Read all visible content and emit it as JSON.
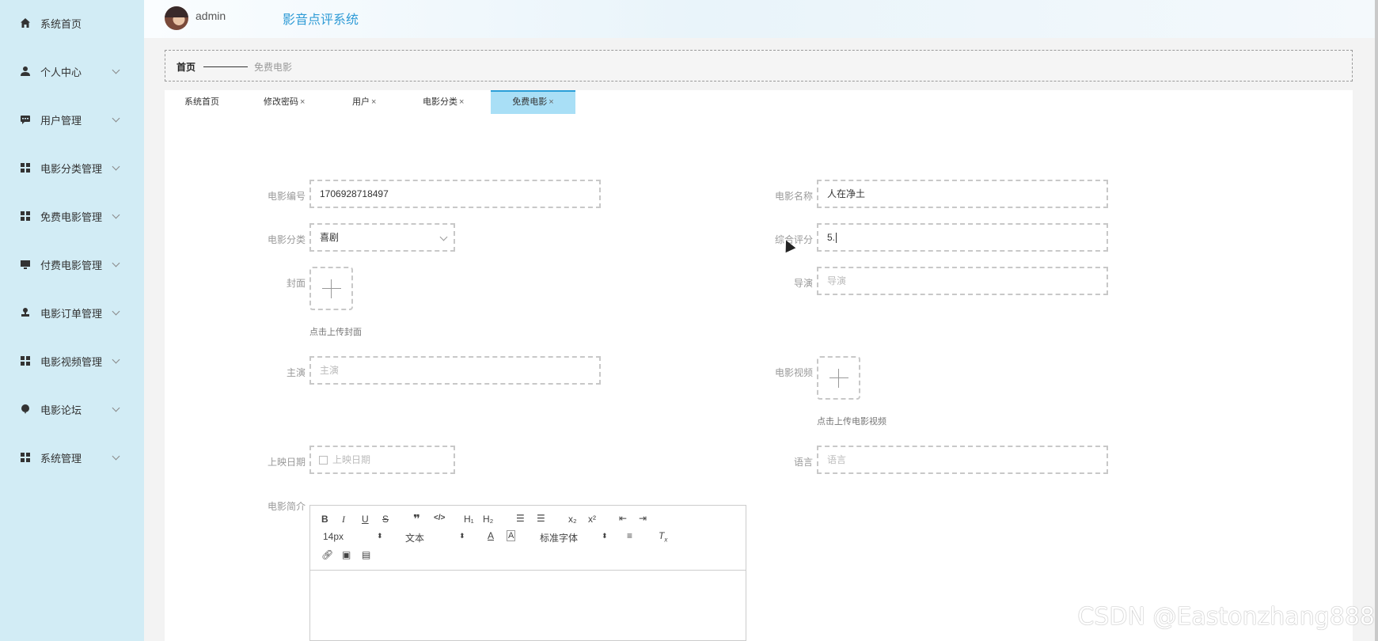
{
  "app": {
    "title": "影音点评系统",
    "username": "admin"
  },
  "sidebar": {
    "items": [
      {
        "label": "系统首页",
        "icon": "home-icon",
        "has_children": false
      },
      {
        "label": "个人中心",
        "icon": "user-icon",
        "has_children": true
      },
      {
        "label": "用户管理",
        "icon": "chat-icon",
        "has_children": true
      },
      {
        "label": "电影分类管理",
        "icon": "grid-icon",
        "has_children": true
      },
      {
        "label": "免费电影管理",
        "icon": "grid-icon",
        "has_children": true
      },
      {
        "label": "付费电影管理",
        "icon": "monitor-icon",
        "has_children": true
      },
      {
        "label": "电影订单管理",
        "icon": "stamp-icon",
        "has_children": true
      },
      {
        "label": "电影视频管理",
        "icon": "grid-icon",
        "has_children": true
      },
      {
        "label": "电影论坛",
        "icon": "balloon-icon",
        "has_children": true
      },
      {
        "label": "系统管理",
        "icon": "grid-icon",
        "has_children": true
      }
    ]
  },
  "breadcrumb": {
    "home": "首页",
    "current": "免费电影"
  },
  "tabs": [
    {
      "label": "系统首页",
      "closable": false,
      "active": false
    },
    {
      "label": "修改密码",
      "closable": true,
      "active": false
    },
    {
      "label": "用户",
      "closable": true,
      "active": false
    },
    {
      "label": "电影分类",
      "closable": true,
      "active": false
    },
    {
      "label": "免费电影",
      "closable": true,
      "active": true
    }
  ],
  "tab_close_glyph": "×",
  "form": {
    "movie_no": {
      "label": "电影编号",
      "value": "1706928718497"
    },
    "movie_name": {
      "label": "电影名称",
      "value": "人在净土"
    },
    "category": {
      "label": "电影分类",
      "value": "喜剧"
    },
    "rating": {
      "label": "综合评分",
      "value": "5."
    },
    "cover": {
      "label": "封面",
      "tip": "点击上传封面"
    },
    "director": {
      "label": "导演",
      "placeholder": "导演"
    },
    "actors": {
      "label": "主演",
      "placeholder": "主演"
    },
    "video": {
      "label": "电影视频",
      "tip": "点击上传电影视频"
    },
    "release_date": {
      "label": "上映日期",
      "placeholder": "上映日期"
    },
    "language": {
      "label": "语言",
      "placeholder": "语言"
    },
    "intro": {
      "label": "电影简介"
    }
  },
  "editor": {
    "font_size": "14px",
    "text_type": "文本",
    "font_family": "标准字体"
  },
  "watermark": "CSDN @Eastonzhang888"
}
